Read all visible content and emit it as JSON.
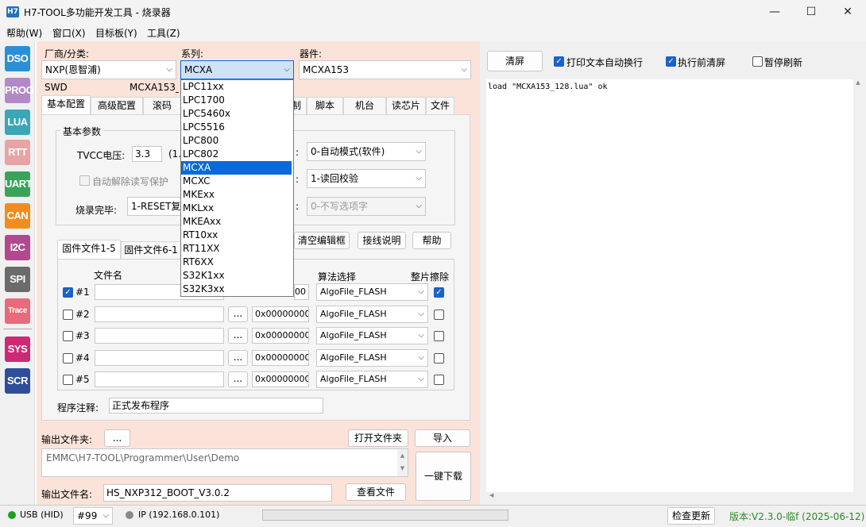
{
  "window": {
    "app_icon": "H7",
    "title": "H7-TOOL多功能开发工具 - 烧录器",
    "minimize": "—",
    "maximize": "☐",
    "close": "✕"
  },
  "menu": [
    "帮助(W)",
    "窗口(X)",
    "目标板(Y)",
    "工具(Z)"
  ],
  "sidebar": [
    {
      "label": "DSO",
      "color": "#2a8fd6"
    },
    {
      "label": "PROG",
      "color": "#b388c9"
    },
    {
      "label": "LUA",
      "color": "#3aa6b8"
    },
    {
      "label": "RTT",
      "color": "#e7a4a4"
    },
    {
      "label": "UART",
      "color": "#3aa35a"
    },
    {
      "label": "CAN",
      "color": "#f28c1e"
    },
    {
      "label": "I2C",
      "color": "#b2498f"
    },
    {
      "label": "SPI",
      "color": "#6b6b6b"
    },
    {
      "label": "Trace",
      "color": "#e86a7b"
    },
    {
      "label": "SYS",
      "color": "#cc2a74"
    },
    {
      "label": "SCR",
      "color": "#2e4e9a"
    }
  ],
  "top": {
    "vendor_label": "厂商/分类:",
    "vendor_value": "NXP(恩智浦)",
    "series_label": "系列:",
    "series_value": "MCXA",
    "device_label": "器件:",
    "device_value": "MCXA153",
    "iface": "SWD",
    "device_info": "MCXA153_128"
  },
  "series_options": [
    "LPC11xx",
    "LPC1700",
    "LPC5460x",
    "LPC5516",
    "LPC800",
    "LPC802",
    "MCXA",
    "MCXC",
    "MKExx",
    "MKLxx",
    "MKEAxx",
    "RT10xx",
    "RT11XX",
    "RT6XX",
    "S32K1xx",
    "S32K3xx"
  ],
  "series_selected_index": 6,
  "tabs": [
    "基本配置",
    "高级配置",
    "滚码",
    "",
    "脚本",
    "机台",
    "读芯片",
    "文件"
  ],
  "tab_partial": "制",
  "basic": {
    "group_title": "基本参数",
    "tvcc_label": "TVCC电压:",
    "tvcc_value": "3.3",
    "tvcc_suffix": "(1.",
    "auto_unlock": "自动解除读写保护",
    "done_label": "烧录完毕:",
    "done_value": "1-RESET复",
    "mode_value": "0-自动模式(软件)",
    "verify_value": "1-读回校验",
    "option_value": "0-不写选项字"
  },
  "buttons": {
    "clear_editor": "清空编辑框",
    "wiring": "接线说明",
    "help": "帮助"
  },
  "fw_tabs": [
    "固件文件1-5",
    "固件文件6-1"
  ],
  "fw_headers": {
    "filename": "文件名",
    "algo": "算法选择",
    "erase": "整片擦除"
  },
  "fw_rows": [
    {
      "num": "#1",
      "checked": true,
      "addr": "0x00000000",
      "addr_visible": "00",
      "algo": "AlgoFile_FLASH",
      "erase": true
    },
    {
      "num": "#2",
      "checked": false,
      "addr": "0x00000000",
      "algo": "AlgoFile_FLASH",
      "erase": false
    },
    {
      "num": "#3",
      "checked": false,
      "addr": "0x00000000",
      "algo": "AlgoFile_FLASH",
      "erase": false
    },
    {
      "num": "#4",
      "checked": false,
      "addr": "0x00000000",
      "algo": "AlgoFile_FLASH",
      "erase": false
    },
    {
      "num": "#5",
      "checked": false,
      "addr": "0x00000000",
      "algo": "AlgoFile_FLASH",
      "erase": false
    }
  ],
  "browse": "...",
  "comment_label": "程序注释:",
  "comment_value": "正式发布程序",
  "output": {
    "folder_label": "输出文件夹:",
    "folder_btn": "...",
    "open_folder": "打开文件夹",
    "import": "导入",
    "path": "EMMC\\H7-TOOL\\Programmer\\User\\Demo",
    "name_label": "输出文件名:",
    "name_value": "HS_NXP312_BOOT_V3.0.2",
    "view_file": "查看文件",
    "download": "一键下载"
  },
  "right": {
    "clear": "清屏",
    "wrap": "打印文本自动换行",
    "clear_before": "执行前清屏",
    "pause": "暂停刷新",
    "log": "load \"MCXA153_128.lua\" ok"
  },
  "status": {
    "usb": "USB (HID)",
    "port": "#99",
    "ip": "IP (192.168.0.101)",
    "update": "检查更新",
    "version": "版本:V2.3.0-临f (2025-06-12)"
  }
}
